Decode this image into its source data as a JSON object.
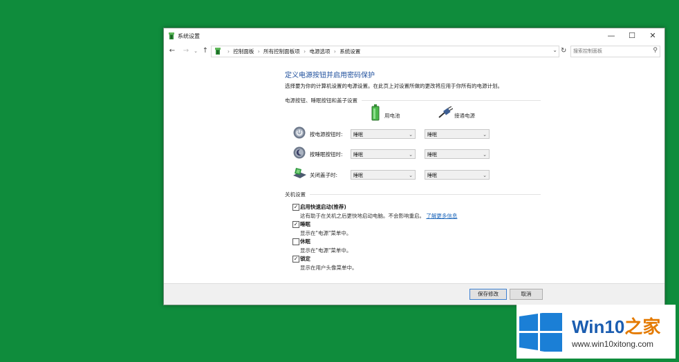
{
  "window": {
    "title": "系统设置",
    "controls": {
      "minimize": "—",
      "maximize": "☐",
      "close": "✕"
    }
  },
  "addressbar": {
    "back": "←",
    "forward": "→",
    "recent": "⌄",
    "up": "↑",
    "breadcrumb": [
      "控制面板",
      "所有控制面板项",
      "电源选项",
      "系统设置"
    ],
    "separator": "›",
    "dropdown": "⌄",
    "refresh": "↻",
    "search_placeholder": "搜索控制面板",
    "search_icon": "⚲"
  },
  "main": {
    "heading": "定义电源按钮并启用密码保护",
    "description": "选择要为你的计算机设置的电源设置。在此页上对设置所做的更改将应用于你所有的电源计划。",
    "buttons_section_title": "电源按钮、睡眠按钮和盖子设置",
    "columns": {
      "battery": "用电池",
      "plugged": "接通电源"
    },
    "rows": [
      {
        "label": "按电源按钮时:",
        "icon": "power-icon",
        "battery": "睡眠",
        "plugged": "睡眠"
      },
      {
        "label": "按睡眠按钮时:",
        "icon": "sleep-icon",
        "battery": "睡眠",
        "plugged": "睡眠"
      },
      {
        "label": "关闭盖子时:",
        "icon": "laptop-lid-icon",
        "battery": "睡眠",
        "plugged": "睡眠"
      }
    ],
    "dropdown_arrow": "⌄",
    "shutdown_section_title": "关机设置",
    "shutdown_options": [
      {
        "label": "启用快速启动(推荐)",
        "checked": true,
        "description": "这有助于在关机之后更快地启动电脑。不会影响重启。",
        "link": "了解更多信息"
      },
      {
        "label": "睡眠",
        "checked": true,
        "description": "显示在\"电源\"菜单中。"
      },
      {
        "label": "休眠",
        "checked": false,
        "description": "显示在\"电源\"菜单中。"
      },
      {
        "label": "锁定",
        "checked": true,
        "description": "显示在用户头像菜单中。"
      }
    ],
    "check_mark": "✓"
  },
  "footer": {
    "save": "保存修改",
    "cancel": "取消"
  },
  "watermark": {
    "title_a": "Win10",
    "title_b": "之家",
    "url": "www.win10xitong.com"
  },
  "colors": {
    "desktop": "#0f8c3c",
    "heading": "#1e4f9c",
    "link": "#1a64b9",
    "logo_blue": "#1b5db0",
    "logo_orange": "#e47a00"
  }
}
